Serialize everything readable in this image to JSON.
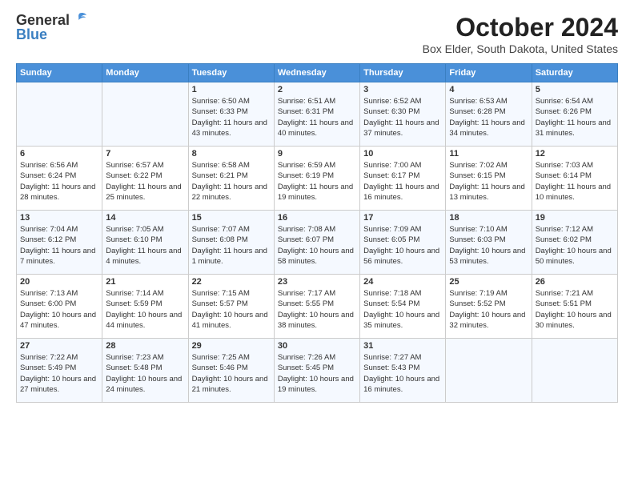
{
  "logo": {
    "general": "General",
    "blue": "Blue"
  },
  "title": "October 2024",
  "location": "Box Elder, South Dakota, United States",
  "weekdays": [
    "Sunday",
    "Monday",
    "Tuesday",
    "Wednesday",
    "Thursday",
    "Friday",
    "Saturday"
  ],
  "weeks": [
    [
      {
        "day": "",
        "sunrise": "",
        "sunset": "",
        "daylight": ""
      },
      {
        "day": "",
        "sunrise": "",
        "sunset": "",
        "daylight": ""
      },
      {
        "day": "1",
        "sunrise": "Sunrise: 6:50 AM",
        "sunset": "Sunset: 6:33 PM",
        "daylight": "Daylight: 11 hours and 43 minutes."
      },
      {
        "day": "2",
        "sunrise": "Sunrise: 6:51 AM",
        "sunset": "Sunset: 6:31 PM",
        "daylight": "Daylight: 11 hours and 40 minutes."
      },
      {
        "day": "3",
        "sunrise": "Sunrise: 6:52 AM",
        "sunset": "Sunset: 6:30 PM",
        "daylight": "Daylight: 11 hours and 37 minutes."
      },
      {
        "day": "4",
        "sunrise": "Sunrise: 6:53 AM",
        "sunset": "Sunset: 6:28 PM",
        "daylight": "Daylight: 11 hours and 34 minutes."
      },
      {
        "day": "5",
        "sunrise": "Sunrise: 6:54 AM",
        "sunset": "Sunset: 6:26 PM",
        "daylight": "Daylight: 11 hours and 31 minutes."
      }
    ],
    [
      {
        "day": "6",
        "sunrise": "Sunrise: 6:56 AM",
        "sunset": "Sunset: 6:24 PM",
        "daylight": "Daylight: 11 hours and 28 minutes."
      },
      {
        "day": "7",
        "sunrise": "Sunrise: 6:57 AM",
        "sunset": "Sunset: 6:22 PM",
        "daylight": "Daylight: 11 hours and 25 minutes."
      },
      {
        "day": "8",
        "sunrise": "Sunrise: 6:58 AM",
        "sunset": "Sunset: 6:21 PM",
        "daylight": "Daylight: 11 hours and 22 minutes."
      },
      {
        "day": "9",
        "sunrise": "Sunrise: 6:59 AM",
        "sunset": "Sunset: 6:19 PM",
        "daylight": "Daylight: 11 hours and 19 minutes."
      },
      {
        "day": "10",
        "sunrise": "Sunrise: 7:00 AM",
        "sunset": "Sunset: 6:17 PM",
        "daylight": "Daylight: 11 hours and 16 minutes."
      },
      {
        "day": "11",
        "sunrise": "Sunrise: 7:02 AM",
        "sunset": "Sunset: 6:15 PM",
        "daylight": "Daylight: 11 hours and 13 minutes."
      },
      {
        "day": "12",
        "sunrise": "Sunrise: 7:03 AM",
        "sunset": "Sunset: 6:14 PM",
        "daylight": "Daylight: 11 hours and 10 minutes."
      }
    ],
    [
      {
        "day": "13",
        "sunrise": "Sunrise: 7:04 AM",
        "sunset": "Sunset: 6:12 PM",
        "daylight": "Daylight: 11 hours and 7 minutes."
      },
      {
        "day": "14",
        "sunrise": "Sunrise: 7:05 AM",
        "sunset": "Sunset: 6:10 PM",
        "daylight": "Daylight: 11 hours and 4 minutes."
      },
      {
        "day": "15",
        "sunrise": "Sunrise: 7:07 AM",
        "sunset": "Sunset: 6:08 PM",
        "daylight": "Daylight: 11 hours and 1 minute."
      },
      {
        "day": "16",
        "sunrise": "Sunrise: 7:08 AM",
        "sunset": "Sunset: 6:07 PM",
        "daylight": "Daylight: 10 hours and 58 minutes."
      },
      {
        "day": "17",
        "sunrise": "Sunrise: 7:09 AM",
        "sunset": "Sunset: 6:05 PM",
        "daylight": "Daylight: 10 hours and 56 minutes."
      },
      {
        "day": "18",
        "sunrise": "Sunrise: 7:10 AM",
        "sunset": "Sunset: 6:03 PM",
        "daylight": "Daylight: 10 hours and 53 minutes."
      },
      {
        "day": "19",
        "sunrise": "Sunrise: 7:12 AM",
        "sunset": "Sunset: 6:02 PM",
        "daylight": "Daylight: 10 hours and 50 minutes."
      }
    ],
    [
      {
        "day": "20",
        "sunrise": "Sunrise: 7:13 AM",
        "sunset": "Sunset: 6:00 PM",
        "daylight": "Daylight: 10 hours and 47 minutes."
      },
      {
        "day": "21",
        "sunrise": "Sunrise: 7:14 AM",
        "sunset": "Sunset: 5:59 PM",
        "daylight": "Daylight: 10 hours and 44 minutes."
      },
      {
        "day": "22",
        "sunrise": "Sunrise: 7:15 AM",
        "sunset": "Sunset: 5:57 PM",
        "daylight": "Daylight: 10 hours and 41 minutes."
      },
      {
        "day": "23",
        "sunrise": "Sunrise: 7:17 AM",
        "sunset": "Sunset: 5:55 PM",
        "daylight": "Daylight: 10 hours and 38 minutes."
      },
      {
        "day": "24",
        "sunrise": "Sunrise: 7:18 AM",
        "sunset": "Sunset: 5:54 PM",
        "daylight": "Daylight: 10 hours and 35 minutes."
      },
      {
        "day": "25",
        "sunrise": "Sunrise: 7:19 AM",
        "sunset": "Sunset: 5:52 PM",
        "daylight": "Daylight: 10 hours and 32 minutes."
      },
      {
        "day": "26",
        "sunrise": "Sunrise: 7:21 AM",
        "sunset": "Sunset: 5:51 PM",
        "daylight": "Daylight: 10 hours and 30 minutes."
      }
    ],
    [
      {
        "day": "27",
        "sunrise": "Sunrise: 7:22 AM",
        "sunset": "Sunset: 5:49 PM",
        "daylight": "Daylight: 10 hours and 27 minutes."
      },
      {
        "day": "28",
        "sunrise": "Sunrise: 7:23 AM",
        "sunset": "Sunset: 5:48 PM",
        "daylight": "Daylight: 10 hours and 24 minutes."
      },
      {
        "day": "29",
        "sunrise": "Sunrise: 7:25 AM",
        "sunset": "Sunset: 5:46 PM",
        "daylight": "Daylight: 10 hours and 21 minutes."
      },
      {
        "day": "30",
        "sunrise": "Sunrise: 7:26 AM",
        "sunset": "Sunset: 5:45 PM",
        "daylight": "Daylight: 10 hours and 19 minutes."
      },
      {
        "day": "31",
        "sunrise": "Sunrise: 7:27 AM",
        "sunset": "Sunset: 5:43 PM",
        "daylight": "Daylight: 10 hours and 16 minutes."
      },
      {
        "day": "",
        "sunrise": "",
        "sunset": "",
        "daylight": ""
      },
      {
        "day": "",
        "sunrise": "",
        "sunset": "",
        "daylight": ""
      }
    ]
  ]
}
